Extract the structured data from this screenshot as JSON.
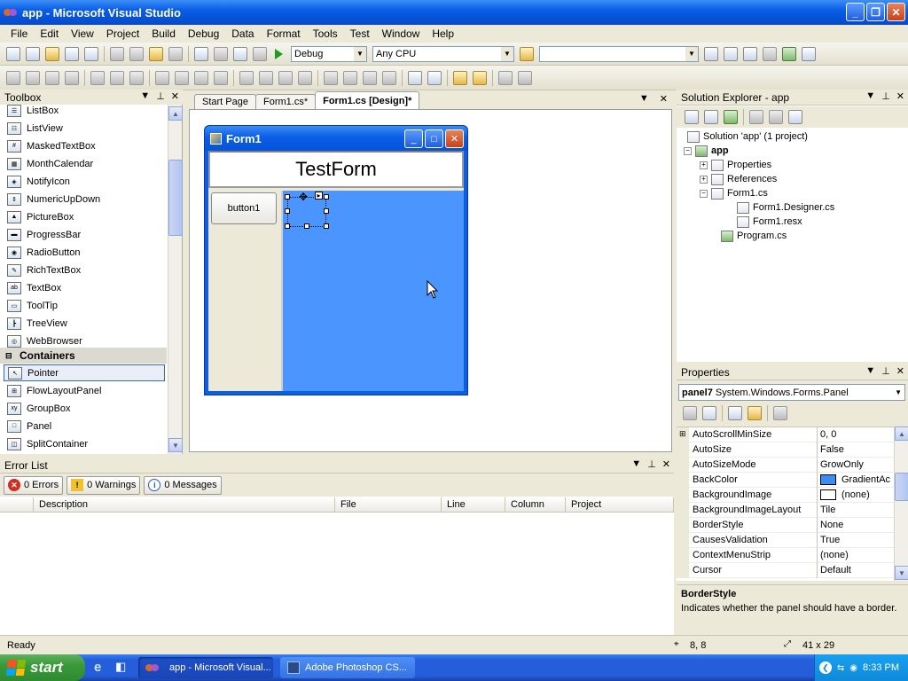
{
  "window": {
    "title": "app - Microsoft Visual Studio"
  },
  "menu": [
    "File",
    "Edit",
    "View",
    "Project",
    "Build",
    "Debug",
    "Data",
    "Format",
    "Tools",
    "Test",
    "Window",
    "Help"
  ],
  "toolbar": {
    "config": "Debug",
    "platform": "Any CPU",
    "find_value": ""
  },
  "toolbox": {
    "title": "Toolbox",
    "items": [
      "ListBox",
      "ListView",
      "MaskedTextBox",
      "MonthCalendar",
      "NotifyIcon",
      "NumericUpDown",
      "PictureBox",
      "ProgressBar",
      "RadioButton",
      "RichTextBox",
      "TextBox",
      "ToolTip",
      "TreeView",
      "WebBrowser"
    ],
    "category": "Containers",
    "container_items": [
      "Pointer",
      "FlowLayoutPanel",
      "GroupBox",
      "Panel",
      "SplitContainer"
    ],
    "selected": "Pointer"
  },
  "editor": {
    "tabs": [
      "Start Page",
      "Form1.cs*",
      "Form1.cs [Design]*"
    ],
    "active_tab": "Form1.cs [Design]*",
    "form": {
      "title": "Form1",
      "header_text": "TestForm",
      "button_text": "button1",
      "panel_color": "#4a95ff"
    }
  },
  "errors": {
    "title": "Error List",
    "errors_btn": "0 Errors",
    "warnings_btn": "0 Warnings",
    "messages_btn": "0 Messages",
    "columns": [
      "Description",
      "File",
      "Line",
      "Column",
      "Project"
    ]
  },
  "solution": {
    "title": "Solution Explorer - app",
    "root": "Solution 'app' (1 project)",
    "project": "app",
    "nodes": [
      "Properties",
      "References",
      "Form1.cs",
      "Form1.Designer.cs",
      "Form1.resx",
      "Program.cs"
    ]
  },
  "properties": {
    "title": "Properties",
    "object": "panel7",
    "object_type": "System.Windows.Forms.Panel",
    "rows": [
      {
        "name": "AutoScrollMinSize",
        "value": "0, 0"
      },
      {
        "name": "AutoSize",
        "value": "False"
      },
      {
        "name": "AutoSizeMode",
        "value": "GrowOnly"
      },
      {
        "name": "BackColor",
        "value": "GradientAc"
      },
      {
        "name": "BackgroundImage",
        "value": "(none)"
      },
      {
        "name": "BackgroundImageLayout",
        "value": "Tile"
      },
      {
        "name": "BorderStyle",
        "value": "None"
      },
      {
        "name": "CausesValidation",
        "value": "True"
      },
      {
        "name": "ContextMenuStrip",
        "value": "(none)"
      },
      {
        "name": "Cursor",
        "value": "Default"
      }
    ],
    "desc_title": "BorderStyle",
    "desc_text": "Indicates whether the panel should have a border.",
    "backcolor": "#3b8ef0"
  },
  "status": {
    "text": "Ready",
    "position": "8, 8",
    "size": "41 x 29"
  },
  "taskbar": {
    "start": "start",
    "tasks": [
      "app - Microsoft Visual...",
      "Adobe Photoshop CS..."
    ],
    "clock": "8:33 PM"
  }
}
